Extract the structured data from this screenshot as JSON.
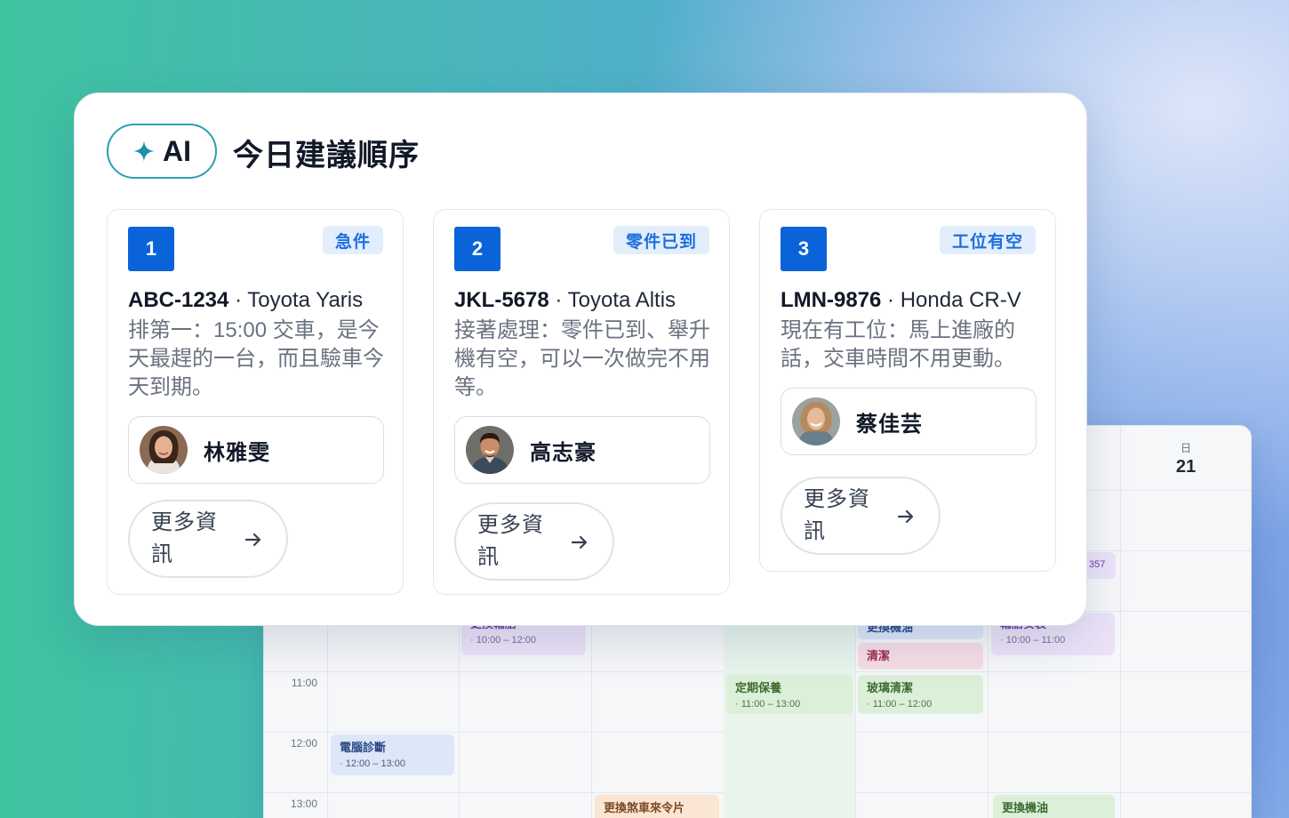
{
  "ai_panel": {
    "badge": "AI",
    "title": "今日建議順序",
    "tasks": [
      {
        "rank": "1",
        "tag": "急件",
        "plate": "ABC-1234",
        "model": "· Toyota Yaris",
        "reason": "排第一：15:00 交車，是今天最趕的一台，而且驗車今天到期。",
        "technician": "林雅雯",
        "more_label": "更多資訊"
      },
      {
        "rank": "2",
        "tag": "零件已到",
        "plate": "JKL-5678",
        "model": "· Toyota Altis",
        "reason": "接著處理：零件已到、舉升機有空，可以一次做完不用等。",
        "technician": "高志豪",
        "more_label": "更多資訊"
      },
      {
        "rank": "3",
        "tag": "工位有空",
        "plate": "LMN-9876",
        "model": "· Honda CR-V",
        "reason": "現在有工位：馬上進廠的話，交車時間不用更動。",
        "technician": "蔡佳芸",
        "more_label": "更多資訊"
      }
    ]
  },
  "calendar": {
    "day_header": {
      "name": "日",
      "number": "21"
    },
    "times": [
      "11:00",
      "12:00",
      "13:00"
    ],
    "events": {
      "e1": {
        "title": "更換輪胎",
        "time": "· 10:00 – 12:00"
      },
      "e2": {
        "title": "更換機油"
      },
      "e3": {
        "title": "清潔"
      },
      "e4": {
        "title": "輪胎安裝",
        "time": "· 10:00 – 11:00"
      },
      "e5": {
        "title": "定期保養",
        "time": "· 11:00 – 13:00"
      },
      "e6": {
        "title": "玻璃清潔",
        "time": "· 11:00 – 12:00"
      },
      "e7": {
        "title": "電腦診斷",
        "time": "· 12:00 – 13:00"
      },
      "e8": {
        "title": "更換煞車來令片"
      },
      "e9": {
        "title": "更換機油"
      },
      "e10": {
        "title": "357"
      }
    }
  },
  "colors": {
    "accent": "#0a63d8",
    "tag_bg": "#e3eefc",
    "badge_border": "#2aa1b0"
  },
  "icons": {
    "badge": "sparkle-icon",
    "more": "arrow-right-icon"
  }
}
